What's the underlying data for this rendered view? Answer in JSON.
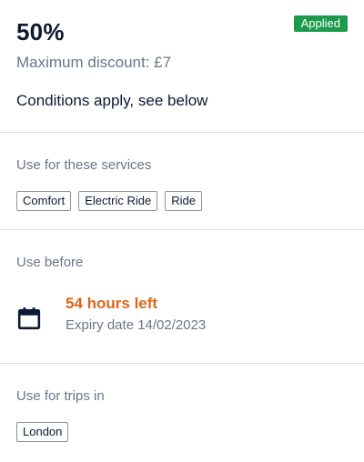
{
  "offer": {
    "percent": "50%",
    "status_badge": "Applied",
    "max_discount": "Maximum discount: £7",
    "conditions": "Conditions apply, see below"
  },
  "services": {
    "title": "Use for these services",
    "tags": [
      "Comfort",
      "Electric Ride",
      "Ride"
    ]
  },
  "use_before": {
    "title": "Use before",
    "icon": "calendar-icon",
    "time_left": "54 hours left",
    "expiry": "Expiry date 14/02/2023"
  },
  "trips": {
    "title": "Use for trips in",
    "tags": [
      "London"
    ]
  },
  "colors": {
    "badge": "#1a9a4a",
    "time_left": "#e0641a"
  }
}
